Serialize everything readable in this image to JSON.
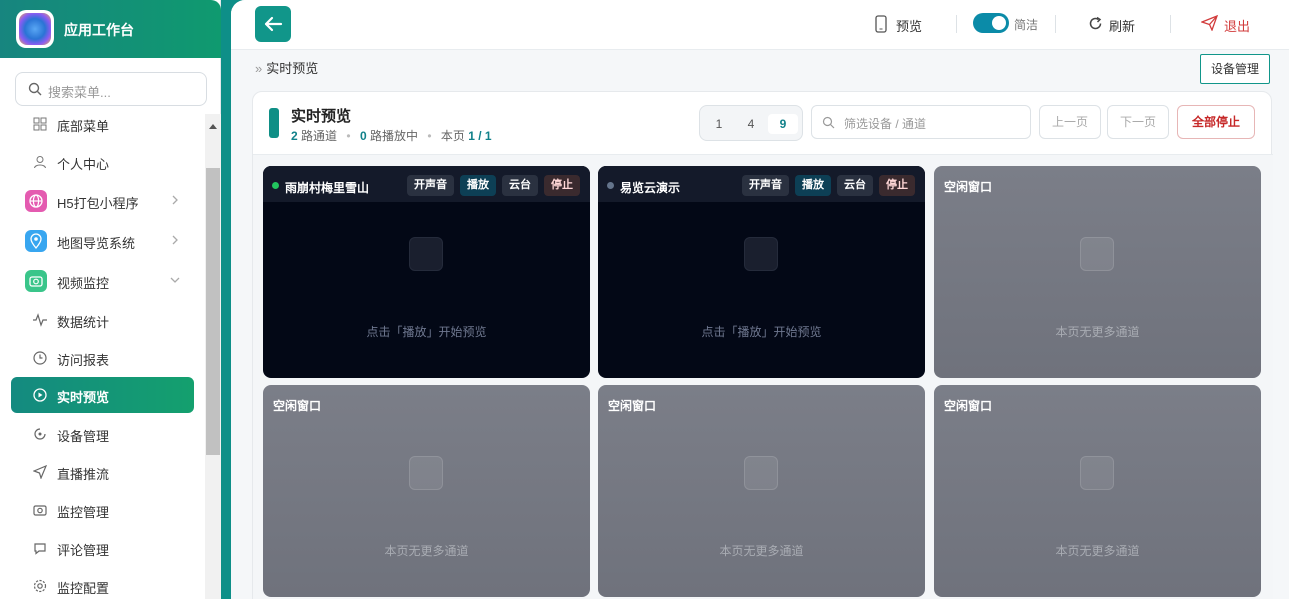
{
  "app": {
    "title": "应用工作台"
  },
  "sidebar": {
    "search_placeholder": "搜索菜单...",
    "items": [
      {
        "label": "底部菜单",
        "icon": "grid-icon"
      },
      {
        "label": "个人中心",
        "icon": "user-icon"
      },
      {
        "label": "H5打包小程序",
        "icon": "globe-icon",
        "color": "#e45bb0"
      },
      {
        "label": "地图导览系统",
        "icon": "map-pin-icon",
        "color": "#38a6f0"
      },
      {
        "label": "视频监控",
        "icon": "camera-icon",
        "color": "#3ac58a"
      },
      {
        "label": "数据统计",
        "icon": "activity-icon"
      },
      {
        "label": "访问报表",
        "icon": "clock-icon"
      },
      {
        "label": "实时预览",
        "icon": "play-circle-icon"
      },
      {
        "label": "设备管理",
        "icon": "device-icon"
      },
      {
        "label": "直播推流",
        "icon": "send-icon"
      },
      {
        "label": "监控管理",
        "icon": "camera-outline-icon"
      },
      {
        "label": "评论管理",
        "icon": "comment-icon"
      },
      {
        "label": "监控配置",
        "icon": "settings-icon"
      }
    ]
  },
  "topbar": {
    "preview_label": "预览",
    "compact_label": "简洁",
    "refresh_label": "刷新",
    "logout_label": "退出"
  },
  "breadcrumb": {
    "current": "实时预览"
  },
  "device_manage_label": "设备管理",
  "panel": {
    "title": "实时预览",
    "channels_count": "2",
    "channels_label": "路通道",
    "playing_count": "0",
    "playing_label": "路播放中",
    "page_label": "本页",
    "page_value": "1 / 1",
    "layouts": [
      "1",
      "4",
      "9"
    ],
    "filter_placeholder": "筛选设备 / 通道",
    "prev_label": "上一页",
    "next_label": "下一页",
    "stop_all_label": "全部停止"
  },
  "tiles": [
    {
      "name": "雨崩村梅里雪山",
      "status_color": "#22c55e",
      "sound": "开声音",
      "play": "播放",
      "ptz": "云台",
      "stop": "停止",
      "message": "点击「播放」开始预览"
    },
    {
      "name": "易览云演示",
      "status_color": "#64748b",
      "sound": "开声音",
      "play": "播放",
      "ptz": "云台",
      "stop": "停止",
      "message": "点击「播放」开始预览"
    },
    {
      "name": "空闲窗口",
      "message": "本页无更多通道"
    },
    {
      "name": "空闲窗口",
      "message": "本页无更多通道"
    },
    {
      "name": "空闲窗口",
      "message": "本页无更多通道"
    },
    {
      "name": "空闲窗口",
      "message": "本页无更多通道"
    }
  ],
  "colors": {
    "accent": "#11968a",
    "danger": "#c62828"
  }
}
